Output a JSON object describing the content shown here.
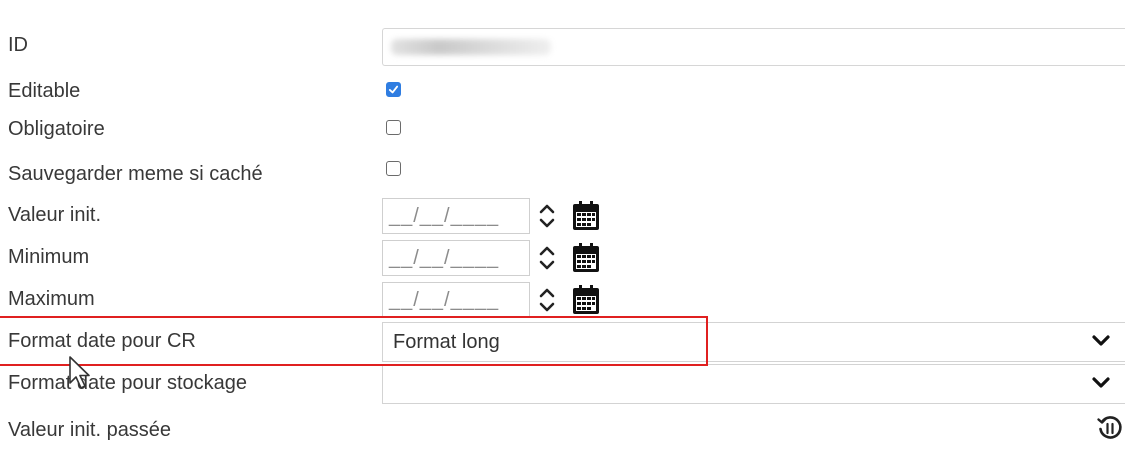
{
  "form": {
    "rows": {
      "id": {
        "label": "ID"
      },
      "editable": {
        "label": "Editable",
        "checked": true
      },
      "obligatoire": {
        "label": "Obligatoire",
        "checked": false
      },
      "sauvegarder": {
        "label": "Sauvegarder meme si caché",
        "checked": false
      },
      "valeur_init": {
        "label": "Valeur init.",
        "date_mask": "__/__/____"
      },
      "minimum": {
        "label": "Minimum",
        "date_mask": "__/__/____"
      },
      "maximum": {
        "label": "Maximum",
        "date_mask": "__/__/____"
      },
      "format_cr": {
        "label": "Format date pour CR",
        "value": "Format long"
      },
      "format_stockage": {
        "label": "Format date pour stockage",
        "value": ""
      },
      "valeur_init_passee": {
        "label": "Valeur init. passée"
      }
    }
  },
  "icons": {
    "checkbox_check": "check-icon",
    "spinner": "up-down-chevron-icon",
    "calendar": "calendar-icon",
    "dropdown": "chevron-down-icon",
    "reset": "history-reset-icon",
    "cursor": "mouse-pointer-icon"
  },
  "colors": {
    "checkbox_checked": "#2f7de1",
    "highlight_border": "#e02020"
  }
}
